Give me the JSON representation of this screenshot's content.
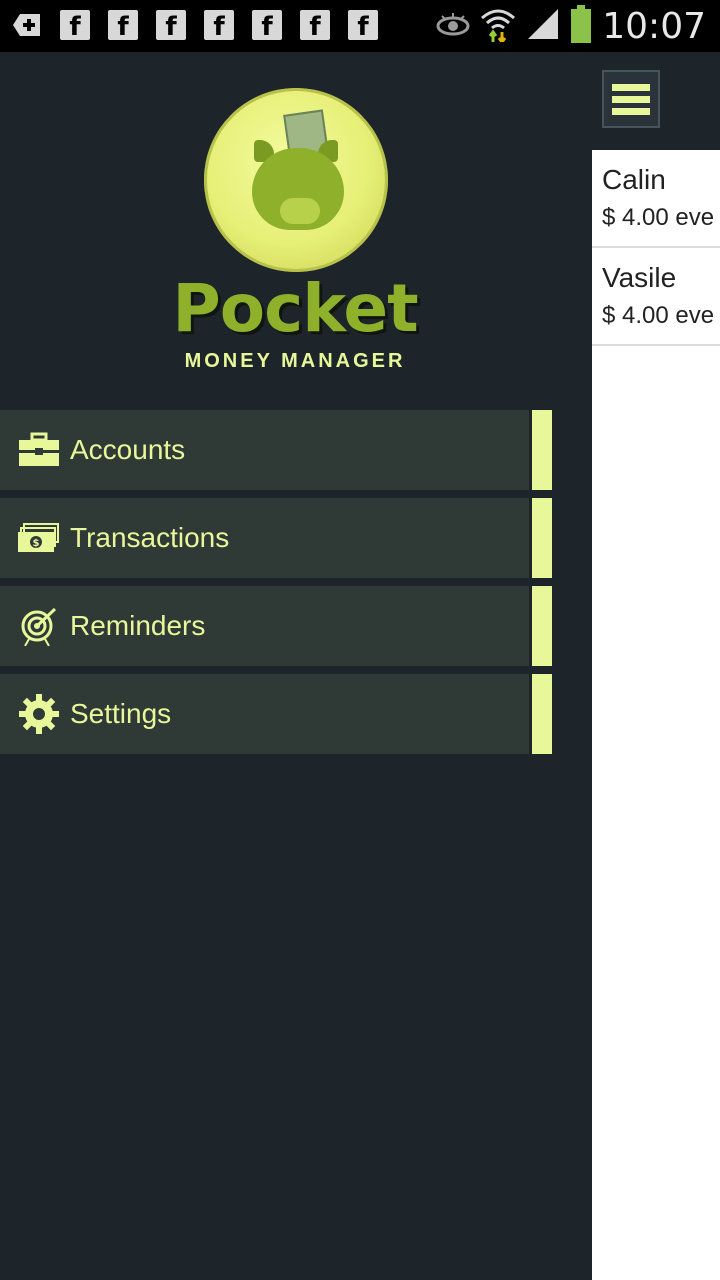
{
  "status_bar": {
    "time": "10:07",
    "notification_icons": [
      "add-icon",
      "facebook-icon",
      "facebook-icon",
      "facebook-icon",
      "facebook-icon",
      "facebook-icon",
      "facebook-icon",
      "facebook-icon"
    ],
    "system_icons": [
      "eye-icon",
      "wifi-icon",
      "signal-icon",
      "battery-icon"
    ]
  },
  "drawer": {
    "logo": {
      "title": "Pocket",
      "subtitle": "MONEY MANAGER"
    },
    "items": [
      {
        "label": "Accounts",
        "icon": "briefcase-icon"
      },
      {
        "label": "Transactions",
        "icon": "money-icon"
      },
      {
        "label": "Reminders",
        "icon": "target-icon"
      },
      {
        "label": "Settings",
        "icon": "gear-icon"
      }
    ]
  },
  "content": {
    "list": [
      {
        "name": "Calin",
        "amount": "$ 4.00 eve"
      },
      {
        "name": "Vasile",
        "amount": "$ 4.00 eve"
      }
    ]
  },
  "colors": {
    "accent": "#e8f79a",
    "background": "#1e252a",
    "nav_item": "#2f3a37",
    "brand_green": "#8fb02b"
  }
}
